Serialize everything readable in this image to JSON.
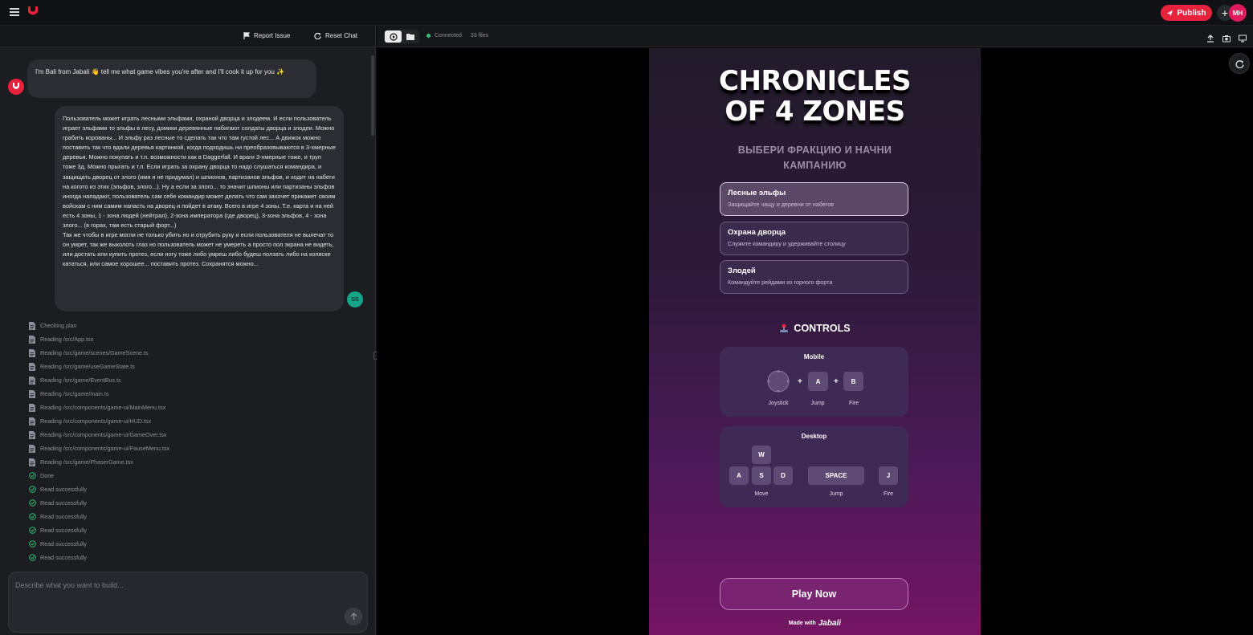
{
  "topbar": {
    "publish_label": "Publish",
    "avatar_initials": "MH"
  },
  "left_header": {
    "report_label": "Report Issue",
    "reset_label": "Reset Chat"
  },
  "chat": {
    "bot_message": "I'm Bali from Jabali 👋 tell me what game vibes you're after and I'll cook it up for you ✨",
    "user_message": "Пользователь может играть лесными эльфами, охраной дворца и злодеем. И если пользователь играет эльфами то эльфы в лесу, домики деревянные набигают солдаты дворца и злодеи. Можно грабить корованы... И эльфу раз лесные то сделать так что там густой лес... А движок можно поставить так что вдали деревья картинкой, когда подходишь ни преобразовываются в 3-хмерные деревья. Можно покупать и т.п. возможности как в Daggerfall. И враги 3-хмерные тоже, и труп тоже 3д. Можно прыгать и т.п. Если играть за охрану дворца то надо слушаться командира, и защищать дворец от злого (имя я не придумал) и шпионов, партизанов эльфов, и ходит на набеги на когото из этих (эльфов, злого...). Ну а если за злого... то значит шпионы или партизаны эльфов иногда нападают, пользователь сам себе командир может делать что сам захочет прикажет своим войскам с ним самим напасть на дворец и пойдет в атаку. Всего в игре 4 зоны. Т.е. карта и на ней есть 4 зоны, 1 - зона людей (нейтрал), 2-зона императора (где дворец), 3-зона эльфов, 4 - зона злого... (в горах, там есть старый форт...)\nТак же чтобы в игре могли не только убить но и отрубить руку и если пользователя не вылечат то он умрет, так же выколоть глаз но пользователь может не умереть а просто пол экрана не видеть, или достать или купить протез, если ногу тоже либо умреш либо будеш ползать либо на коляске кататься, или самое хорошее... поставить протез. Сохранятся можно...",
    "user_initials": "SS",
    "steps": [
      {
        "icon": "doc",
        "text": "Checking plan"
      },
      {
        "icon": "doc",
        "text": "Reading /src/App.tsx"
      },
      {
        "icon": "doc",
        "text": "Reading /src/game/scenes/GameScene.ts"
      },
      {
        "icon": "doc",
        "text": "Reading /src/game/useGameState.ts"
      },
      {
        "icon": "doc",
        "text": "Reading /src/game/EventBus.ts"
      },
      {
        "icon": "doc",
        "text": "Reading /src/game/main.ts"
      },
      {
        "icon": "doc",
        "text": "Reading /src/components/game-ui/MainMenu.tsx"
      },
      {
        "icon": "doc",
        "text": "Reading /src/components/game-ui/HUD.tsx"
      },
      {
        "icon": "doc",
        "text": "Reading /src/components/game-ui/GameOver.tsx"
      },
      {
        "icon": "doc",
        "text": "Reading /src/components/game-ui/PauseMenu.tsx"
      },
      {
        "icon": "doc",
        "text": "Reading /src/game/PhaserGame.tsx"
      },
      {
        "icon": "check",
        "text": "Done"
      },
      {
        "icon": "check",
        "text": "Read successfully"
      },
      {
        "icon": "check",
        "text": "Read successfully"
      },
      {
        "icon": "check",
        "text": "Read successfully"
      },
      {
        "icon": "check",
        "text": "Read successfully"
      },
      {
        "icon": "check",
        "text": "Read successfully"
      },
      {
        "icon": "check",
        "text": "Read successfully"
      }
    ],
    "input_placeholder": "Describe what you want to build..."
  },
  "preview_header": {
    "status": "Connected",
    "files": "33 files"
  },
  "game": {
    "title_line1": "CHRONICLES",
    "title_line2": "OF 4 ZONES",
    "subtitle_line1": "ВЫБЕРИ ФРАКЦИЮ И НАЧНИ",
    "subtitle_line2": "КАМПАНИЮ",
    "factions": [
      {
        "name": "Лесные эльфы",
        "desc": "Защищайте чащу и деревни от набегов",
        "selected": true
      },
      {
        "name": "Охрана дворца",
        "desc": "Служите командиру и удерживайте столицу",
        "selected": false
      },
      {
        "name": "Злодей",
        "desc": "Командуйте рейдами из горного форта",
        "selected": false
      }
    ],
    "controls_title": "CONTROLS",
    "mobile": {
      "title": "Mobile",
      "key_a": "A",
      "key_b": "B",
      "label_joystick": "Joystick",
      "label_jump": "Jump",
      "label_fire": "Fire",
      "plus": "+"
    },
    "desktop": {
      "title": "Desktop",
      "key_w": "W",
      "key_a": "A",
      "key_s": "S",
      "key_d": "D",
      "key_space": "SPACE",
      "key_j": "J",
      "label_move": "Move",
      "label_jump": "Jump",
      "label_fire": "Fire"
    },
    "play_label": "Play Now",
    "made_with": "Made with",
    "brand": "Jabali"
  }
}
